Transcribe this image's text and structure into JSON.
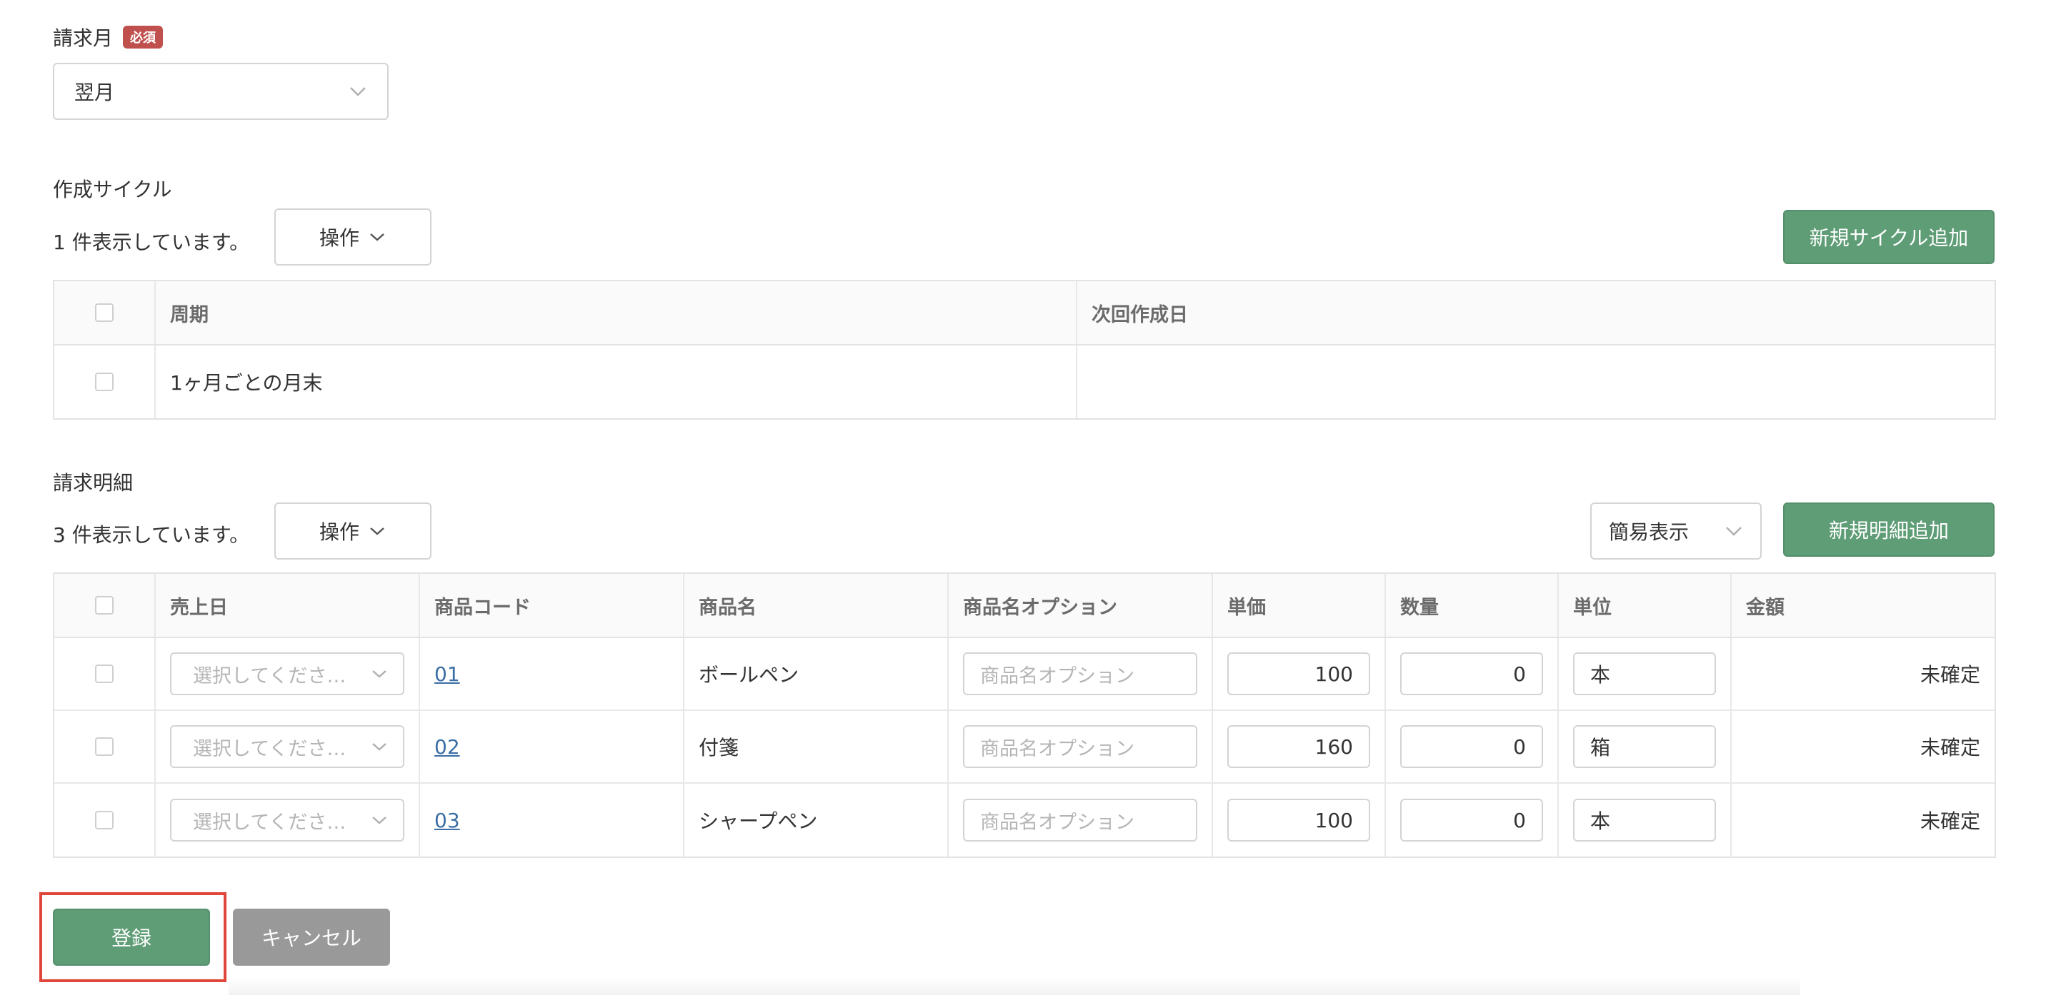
{
  "billing_month": {
    "label": "請求月",
    "required_badge": "必須",
    "selected": "翌月"
  },
  "cycle": {
    "section_title": "作成サイクル",
    "count_text": "1 件表示しています。",
    "operations_label": "操作",
    "add_button": "新規サイクル追加",
    "columns": [
      "周期",
      "次回作成日"
    ],
    "rows": [
      {
        "period": "1ヶ月ごとの月末",
        "next_date": ""
      }
    ]
  },
  "details": {
    "section_title": "請求明細",
    "count_text": "3 件表示しています。",
    "operations_label": "操作",
    "view_mode": "簡易表示",
    "add_button": "新規明細追加",
    "columns": [
      "売上日",
      "商品コード",
      "商品名",
      "商品名オプション",
      "単価",
      "数量",
      "単位",
      "金額"
    ],
    "date_placeholder": "選択してくださ…",
    "option_placeholder": "商品名オプション",
    "rows": [
      {
        "code": "01",
        "name": "ボールペン",
        "price": "100",
        "qty": "0",
        "unit": "本",
        "amount": "未確定"
      },
      {
        "code": "02",
        "name": "付箋",
        "price": "160",
        "qty": "0",
        "unit": "箱",
        "amount": "未確定"
      },
      {
        "code": "03",
        "name": "シャープペン",
        "price": "100",
        "qty": "0",
        "unit": "本",
        "amount": "未確定"
      }
    ]
  },
  "actions": {
    "register": "登録",
    "cancel": "キャンセル"
  },
  "colors": {
    "primary": "#5f9d76",
    "required": "#c0504d",
    "highlight": "#e0463a",
    "cancel": "#999999"
  }
}
